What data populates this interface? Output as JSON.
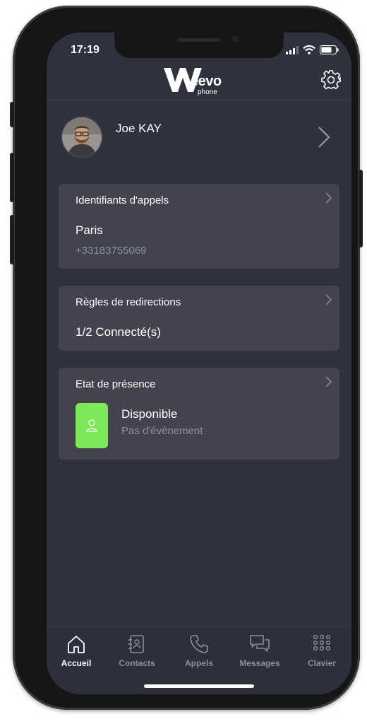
{
  "status_bar": {
    "time": "17:19"
  },
  "brand": {
    "logo_main": "eevo",
    "logo_sub": "phone",
    "color": "#ffffff"
  },
  "profile": {
    "name": "Joe KAY"
  },
  "cards": {
    "caller_id": {
      "title": "Identifiants d'appels",
      "value": "Paris",
      "sub": "+33183755069"
    },
    "redirection": {
      "title": "Règles de redirections",
      "value": "1/2 Connecté(s)"
    },
    "presence": {
      "title": "Etat de présence",
      "value": "Disponible",
      "sub": "Pas d'évènement",
      "status_color": "#7de85a"
    }
  },
  "tabs": [
    {
      "label": "Accueil",
      "icon": "home-icon",
      "active": true
    },
    {
      "label": "Contacts",
      "icon": "contacts-icon",
      "active": false
    },
    {
      "label": "Appels",
      "icon": "phone-icon",
      "active": false
    },
    {
      "label": "Messages",
      "icon": "messages-icon",
      "active": false
    },
    {
      "label": "Clavier",
      "icon": "keypad-icon",
      "active": false
    }
  ],
  "colors": {
    "screen_background": "#30313f",
    "card_background": "#42434f",
    "muted_text": "#8e8fa0",
    "available": "#7de85a"
  }
}
